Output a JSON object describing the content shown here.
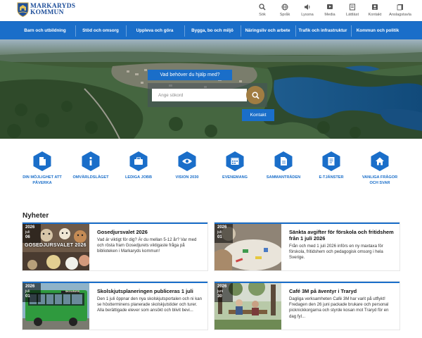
{
  "logo": {
    "line1": "MARKARYDS",
    "line2": "KOMMUN"
  },
  "tools": [
    {
      "label": "Sök",
      "icon": "search-icon"
    },
    {
      "label": "Språk",
      "icon": "language-icon"
    },
    {
      "label": "Lyssna",
      "icon": "speaker-icon"
    },
    {
      "label": "Media",
      "icon": "media-icon"
    },
    {
      "label": "Lättläst",
      "icon": "easy-read-icon"
    },
    {
      "label": "Kontakt",
      "icon": "contact-icon"
    },
    {
      "label": "Anslagstavla",
      "icon": "notice-board-icon"
    }
  ],
  "nav": [
    "Barn och utbildning",
    "Stöd och omsorg",
    "Uppleva och göra",
    "Bygga, bo och miljö",
    "Näringsliv och arbete",
    "Trafik och infrastruktur",
    "Kommun och politik"
  ],
  "hero": {
    "search_label": "Vad behöver du hjälp med?",
    "search_placeholder": "Ange sökord",
    "contact_button": "Kontakt"
  },
  "quick_links": [
    {
      "label": "Din möjlighet att påverka",
      "icon": "document-icon"
    },
    {
      "label": "Omvärldsläget",
      "icon": "info-icon"
    },
    {
      "label": "Lediga jobb",
      "icon": "briefcase-icon"
    },
    {
      "label": "Vision 2030",
      "icon": "eye-icon"
    },
    {
      "label": "Evenemang",
      "icon": "calendar-icon"
    },
    {
      "label": "Sammanträden",
      "icon": "file-icon"
    },
    {
      "label": "E-tjänster",
      "icon": "form-icon"
    },
    {
      "label": "Vanliga frågor och svar",
      "icon": "home-icon"
    }
  ],
  "news": {
    "title": "Nyheter",
    "items": [
      {
        "year": "2026",
        "month": "juli",
        "day": "06",
        "title": "Gosedjursvalet 2026",
        "text": "Vad är viktigt för dig? Är du mellan 5-12 år? Var med och rösta fram Gosedjurets viktigaste fråga på biblioteken i Markaryds kommun!",
        "image_caption": "GOSEDJURSVALET 2026"
      },
      {
        "year": "2026",
        "month": "juli",
        "day": "01",
        "title": "Sänkta avgifter för förskola och fritidshem från 1 juli 2026",
        "text": "Från och med 1 juli 2026 införs en ny maxtaxa för förskola, fritidshem och pedagogisk omsorg i hela Sverige."
      },
      {
        "year": "2026",
        "month": "juli",
        "day": "01",
        "title": "Skolskjutsplaneringen publiceras 1 juli",
        "text": "Den 1 juli öppnar den nya skolskjutsportalen och ni kan se höstterminens planerade skolskjutstider och turer. Alla berättigade elever som ansökt och blivit bevi...",
        "image_caption": "SKOLBUSS"
      },
      {
        "year": "2026",
        "month": "juni",
        "day": "30",
        "title": "Café 3M på äventyr i Traryd",
        "text": "Dagliga verksamheten Café 3M har varit på utflykt! Fredagen den 26 juni packade brukare och personal picknickkorgarna och styrde kosan mot Traryd för en dag fyl..."
      }
    ]
  },
  "colors": {
    "primary": "#1a6ec9",
    "accent_gold": "#a17d42"
  }
}
